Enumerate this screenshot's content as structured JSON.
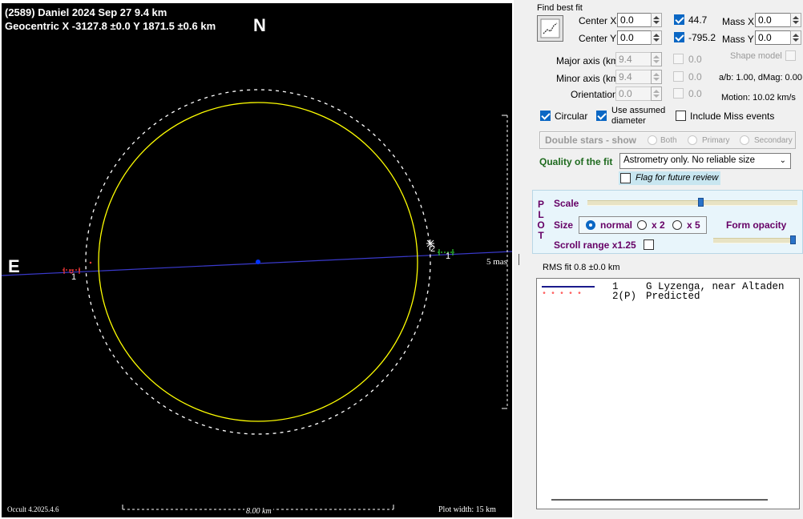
{
  "plot": {
    "title_line1": "(2589) Daniel  2024 Sep 27   9.4 km",
    "title_line2": "Geocentric  X  -3127.8 ±0.0  Y 1871.5 ±0.6 km",
    "north_label": "N",
    "east_label": "E",
    "scale_label": "5 mas",
    "version": "Occult 4.2025.4.6",
    "scale_bar_label": "8.00 km",
    "plot_width": "Plot width: 15 km",
    "chord_left_number": "1",
    "chord_right_number": "1",
    "chord_right_point": "2",
    "colors": {
      "ellipse": "#ffff00",
      "dashed_ellipse": "#ffffff",
      "center": "#0033ff",
      "chord": "#3a3acc",
      "left_marks": "#ff3b3b",
      "right_marks": "#33cc33"
    }
  },
  "find_best_fit": {
    "label": "Find best fit",
    "button_icon": "fit-chart-icon",
    "center_x_label": "Center X",
    "center_x_value": "0.0",
    "center_y_label": "Center Y",
    "center_y_value": "0.0",
    "check_x_value": "44.7",
    "check_x_checked": true,
    "check_y_value": "-795.2",
    "check_y_checked": true,
    "mass_x_label": "Mass X",
    "mass_x_value": "0.0",
    "mass_y_label": "Mass Y",
    "mass_y_value": "0.0",
    "major_axis_label": "Major axis (km)",
    "major_axis_value": "9.4",
    "major_axis_check_value": "0.0",
    "minor_axis_label": "Minor axis (km)",
    "minor_axis_value": "9.4",
    "minor_axis_check_value": "0.0",
    "orientation_label": "Orientation",
    "orientation_value": "0.0",
    "orientation_check_value": "0.0",
    "shape_model_label": "Shape model",
    "ab_dmag": "a/b: 1.00, dMag: 0.00",
    "motion": "Motion: 10.02 km/s",
    "circular_label": "Circular",
    "circular_checked": true,
    "use_assumed_label_1": "Use assumed",
    "use_assumed_label_2": "diameter",
    "use_assumed_checked": true,
    "include_miss_label": "Include Miss events",
    "include_miss_checked": false
  },
  "double_stars": {
    "label": "Double stars - show",
    "options": [
      "Both",
      "Primary",
      "Secondary"
    ],
    "selected": "Both"
  },
  "quality": {
    "label": "Quality of the fit",
    "value": "Astrometry only. No reliable size",
    "flag_label": "Flag for future review",
    "flag_checked": false
  },
  "plot_controls": {
    "plot_letters": [
      "P",
      "L",
      "O",
      "T"
    ],
    "scale_label": "Scale",
    "scale_level": 0.54,
    "size_label": "Size",
    "size_options": [
      "normal",
      "x 2",
      "x 5"
    ],
    "size_selected": "normal",
    "form_opacity_label": "Form opacity",
    "opacity_level": 1.0,
    "scroll_range_label": "Scroll range x1.25",
    "scroll_range_checked": false
  },
  "rms_fit": "RMS fit 0.8 ±0.0 km",
  "legend": {
    "rows": [
      {
        "num": "1",
        "text": "G Lyzenga, near Altaden",
        "style": "line"
      },
      {
        "num": "2(P)",
        "text": "Predicted",
        "style": "dots"
      }
    ]
  }
}
